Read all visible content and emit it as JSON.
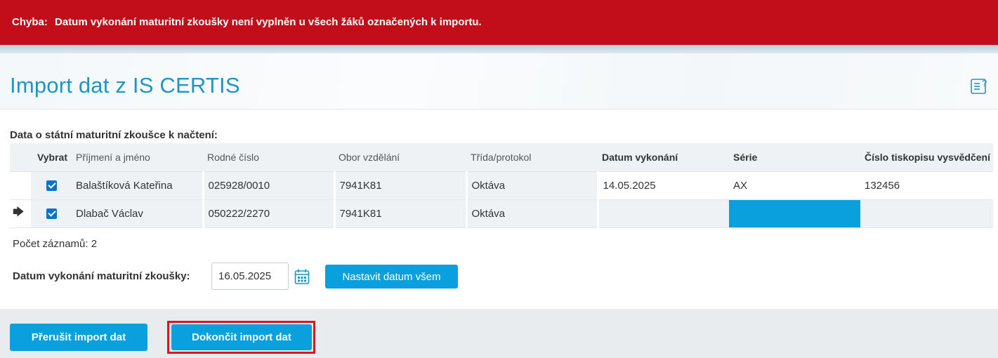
{
  "error": {
    "label": "Chyba:",
    "message": "Datum vykonání maturitní zkoušky není vyplněn u všech žáků označených k importu."
  },
  "page": {
    "title": "Import dat z IS CERTIS",
    "help_icon": "help-list-icon"
  },
  "section_label": "Data o státní maturitní zkoušce k načtení:",
  "table": {
    "columns": [
      "Vybrat",
      "Příjmení a jméno",
      "Rodné číslo",
      "Obor vzdělání",
      "Třída/protokol",
      "Datum vykonání",
      "Série",
      "Číslo tiskopisu vysvědčení"
    ],
    "rows": [
      {
        "selected": true,
        "name": "Balaštíková Kateřina",
        "rc": "025928/0010",
        "obor": "7941K81",
        "trida": "Oktáva",
        "datum": "14.05.2025",
        "serie": "AX",
        "cislo": "132456"
      },
      {
        "selected": true,
        "name": "Dlabač Václav",
        "rc": "050222/2270",
        "obor": "7941K81",
        "trida": "Oktáva",
        "datum": "",
        "serie": "",
        "cislo": ""
      }
    ]
  },
  "count_text": "Počet záznamů: 2",
  "date_form": {
    "label": "Datum vykonání maturitní zkoušky:",
    "value": "16.05.2025",
    "set_all_label": "Nastavit datum všem"
  },
  "footer": {
    "cancel_label": "Přerušit import dat",
    "finish_label": "Dokončit import dat"
  },
  "colors": {
    "error": "#c20e1a",
    "accent": "#0aa0dd",
    "title": "#1d95c9",
    "highlight_outline": "#e0141e"
  }
}
